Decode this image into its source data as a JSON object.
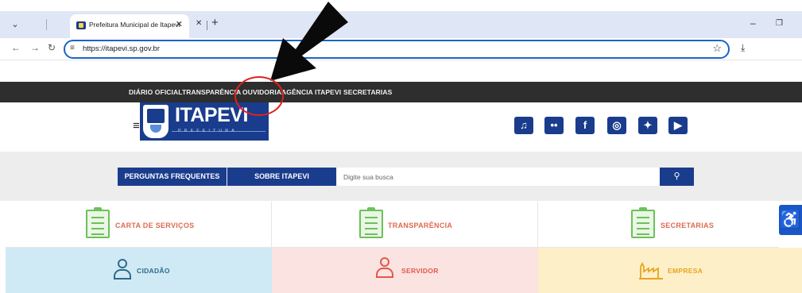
{
  "browser": {
    "tab_title": "Prefeitura Municipal de Itapevi",
    "url": "https://itapevi.sp.gov.br",
    "icons": [
      "chevron-down-icon",
      "close-icon",
      "plus-icon",
      "back-icon",
      "forward-icon",
      "reload-icon",
      "site-settings-icon",
      "star-icon",
      "download-icon",
      "minimize-icon",
      "restore-icon"
    ]
  },
  "topnav": {
    "items": [
      "DIÁRIO OFICIAL",
      "TRANSPARÊNCIA",
      "OUVIDORIA",
      "AGÊNCIA ITAPEVI",
      "SECRETARIAS"
    ]
  },
  "header": {
    "logo_text": "ITAPEVI",
    "logo_sub": "PREFEITURA"
  },
  "social": [
    "tiktok-icon",
    "flickr-icon",
    "facebook-icon",
    "instagram-icon",
    "twitter-icon",
    "youtube-icon"
  ],
  "search": {
    "faq_label": "PERGUNTAS FREQUENTES",
    "about_label": "SOBRE ITAPEVI",
    "placeholder": "Digite sua busca"
  },
  "cards_row1": [
    "CARTA DE SERVIÇOS",
    "TRANSPARÊNCIA",
    "SECRETARIAS"
  ],
  "cards_row2": [
    "CIDADÃO",
    "SERVIDOR",
    "EMPRESA"
  ],
  "colors": {
    "brand_blue": "#1a3c8c",
    "topbar": "#2e2e2e",
    "cidadao_bg": "#cfeaf5",
    "servidor_bg": "#fbe3e1",
    "empresa_bg": "#fdefc8",
    "annotation_red": "#e02020"
  }
}
